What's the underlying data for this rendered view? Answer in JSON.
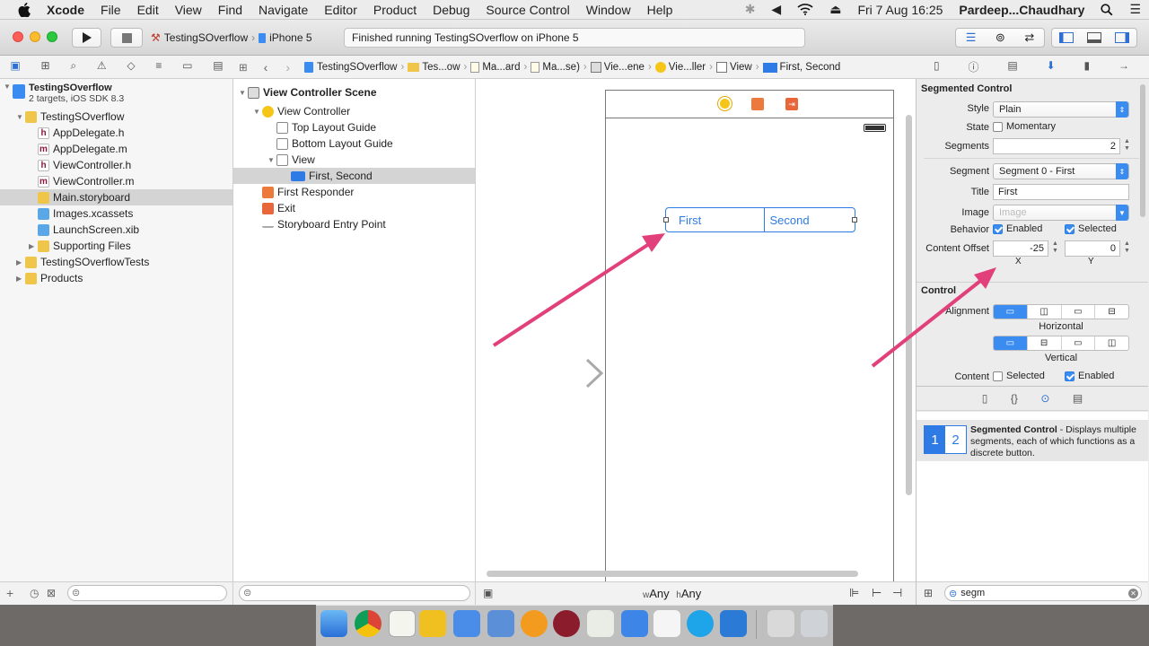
{
  "menubar": {
    "apple": "",
    "app": "Xcode",
    "items": [
      "File",
      "Edit",
      "View",
      "Find",
      "Navigate",
      "Editor",
      "Product",
      "Debug",
      "Source Control",
      "Window",
      "Help"
    ],
    "clock": "Fri 7 Aug  16:25",
    "user": "Pardeep...Chaudhary"
  },
  "toolbar": {
    "scheme": "TestingSOverflow",
    "device": "iPhone 5",
    "status": "Finished running TestingSOverflow on iPhone 5"
  },
  "jumpbar": [
    "TestingSOverflow",
    "Tes...ow",
    "Ma...ard",
    "Ma...se)",
    "Vie...ene",
    "Vie...ller",
    "View",
    "First, Second"
  ],
  "navigator": {
    "project": "TestingSOverflow",
    "project_sub": "2 targets, iOS SDK 8.3",
    "items": [
      {
        "label": "TestingSOverflow",
        "type": "folder",
        "indent": 1,
        "open": true
      },
      {
        "label": "AppDelegate.h",
        "type": "h",
        "indent": 2
      },
      {
        "label": "AppDelegate.m",
        "type": "m",
        "indent": 2
      },
      {
        "label": "ViewController.h",
        "type": "h",
        "indent": 2
      },
      {
        "label": "ViewController.m",
        "type": "m",
        "indent": 2
      },
      {
        "label": "Main.storyboard",
        "type": "sb",
        "indent": 2,
        "selected": true
      },
      {
        "label": "Images.xcassets",
        "type": "xc",
        "indent": 2
      },
      {
        "label": "LaunchScreen.xib",
        "type": "xib",
        "indent": 2
      },
      {
        "label": "Supporting Files",
        "type": "folder",
        "indent": 2,
        "open": false
      },
      {
        "label": "TestingSOverflowTests",
        "type": "folder",
        "indent": 1,
        "open": false
      },
      {
        "label": "Products",
        "type": "folder",
        "indent": 1,
        "open": false
      }
    ]
  },
  "outline": {
    "scene": "View Controller Scene",
    "items": [
      {
        "label": "View Controller",
        "indent": 1,
        "icon": "vc"
      },
      {
        "label": "Top Layout Guide",
        "indent": 2,
        "icon": "guide"
      },
      {
        "label": "Bottom Layout Guide",
        "indent": 2,
        "icon": "guide"
      },
      {
        "label": "View",
        "indent": 2,
        "icon": "view"
      },
      {
        "label": "First, Second",
        "indent": 3,
        "icon": "seg",
        "selected": true
      },
      {
        "label": "First Responder",
        "indent": 1,
        "icon": "fr"
      },
      {
        "label": "Exit",
        "indent": 1,
        "icon": "exit"
      },
      {
        "label": "Storyboard Entry Point",
        "indent": 1,
        "icon": "entry"
      }
    ]
  },
  "canvas": {
    "seg_first": "First",
    "seg_second": "Second",
    "size_w": "w",
    "size_w_val": "Any",
    "size_h": "h",
    "size_h_val": "Any"
  },
  "inspector": {
    "section": "Segmented Control",
    "style_label": "Style",
    "style": "Plain",
    "state_label": "State",
    "momentary": "Momentary",
    "segments_label": "Segments",
    "segments": "2",
    "segment_label": "Segment",
    "segment": "Segment 0 - First",
    "title_label": "Title",
    "title": "First",
    "image_label": "Image",
    "image_placeholder": "Image",
    "behavior_label": "Behavior",
    "enabled": "Enabled",
    "selected": "Selected",
    "offset_label": "Content Offset",
    "offset_x": "-25",
    "offset_y": "0",
    "x": "X",
    "y": "Y",
    "control_section": "Control",
    "alignment_label": "Alignment",
    "horizontal": "Horizontal",
    "vertical": "Vertical",
    "content_label": "Content",
    "content_selected": "Selected",
    "content_enabled": "Enabled"
  },
  "library": {
    "title": "Segmented Control",
    "desc": " - Displays multiple segments, each of which functions as a discrete button.",
    "seg1": "1",
    "seg2": "2",
    "search": "segm"
  },
  "colors": {
    "accent": "#3a8cf0",
    "arrow": "#e2407a",
    "segment_blue": "#2f7be5"
  }
}
